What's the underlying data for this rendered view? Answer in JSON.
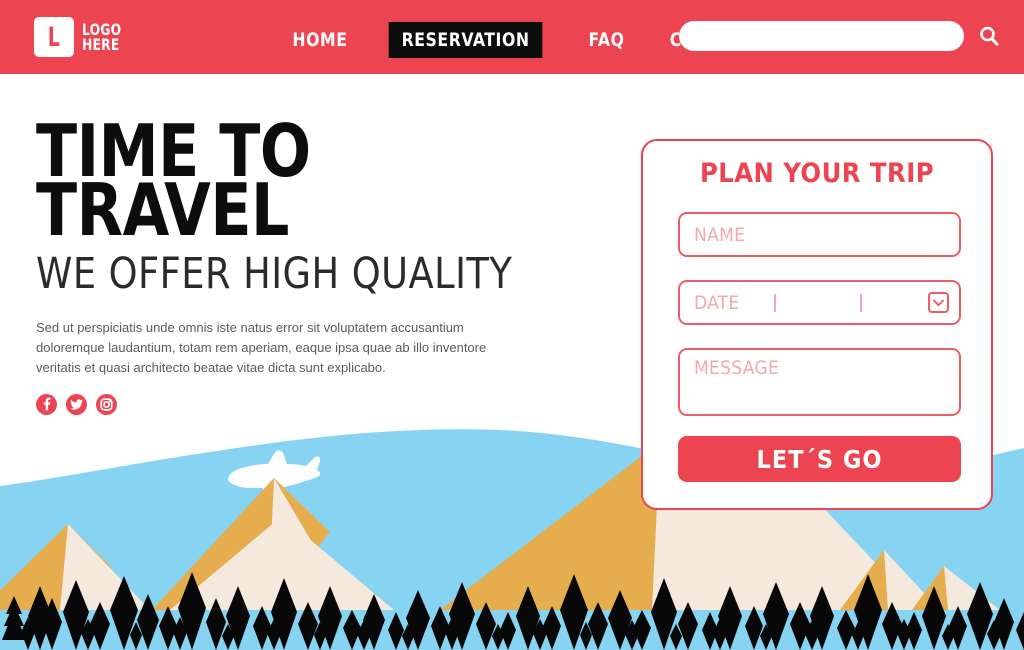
{
  "header": {
    "logo": {
      "mark_letter": "L",
      "line1": "LOGO",
      "line2": "HERE"
    },
    "nav": [
      {
        "label": "HOME",
        "active": false
      },
      {
        "label": "RESERVATION",
        "active": true
      },
      {
        "label": "FAQ",
        "active": false
      },
      {
        "label": "CONTACT",
        "active": false
      }
    ],
    "search": {
      "value": "",
      "placeholder": ""
    },
    "colors": {
      "bar": "#ec4450",
      "active_pill": "#0c0c0c",
      "text": "#ffffff"
    }
  },
  "hero": {
    "title_line1": "TIME TO",
    "title_line2": "TRAVEL",
    "subtitle": "WE OFFER HIGH QUALITY",
    "paragraph": "Sed ut perspiciatis unde omnis iste natus error sit voluptatem accusantium doloremque laudantium, totam rem aperiam, eaque ipsa quae ab illo inventore veritatis et quasi architecto beatae vitae dicta sunt explicabo.",
    "socials": [
      {
        "name": "facebook",
        "glyph": "f"
      },
      {
        "name": "twitter",
        "glyph": "t"
      },
      {
        "name": "instagram",
        "glyph": "i"
      }
    ]
  },
  "form": {
    "title": "PLAN YOUR TRIP",
    "name": {
      "value": "",
      "placeholder": "NAME"
    },
    "date": {
      "value": "",
      "placeholder": "DATE"
    },
    "message": {
      "value": "",
      "placeholder": "MESSAGE"
    },
    "submit_label": "LET´S GO",
    "colors": {
      "accent": "#ec4450",
      "border": "#ee5c66",
      "placeholder": "#f6a7ad"
    }
  },
  "illustration": {
    "sky_color": "#86d3f2",
    "mountain_gold": "#e6ad4e",
    "mountain_cream": "#f5e8dc",
    "tree_color": "#080808",
    "plane_color": "#ffffff",
    "plane_label": "airplane"
  }
}
